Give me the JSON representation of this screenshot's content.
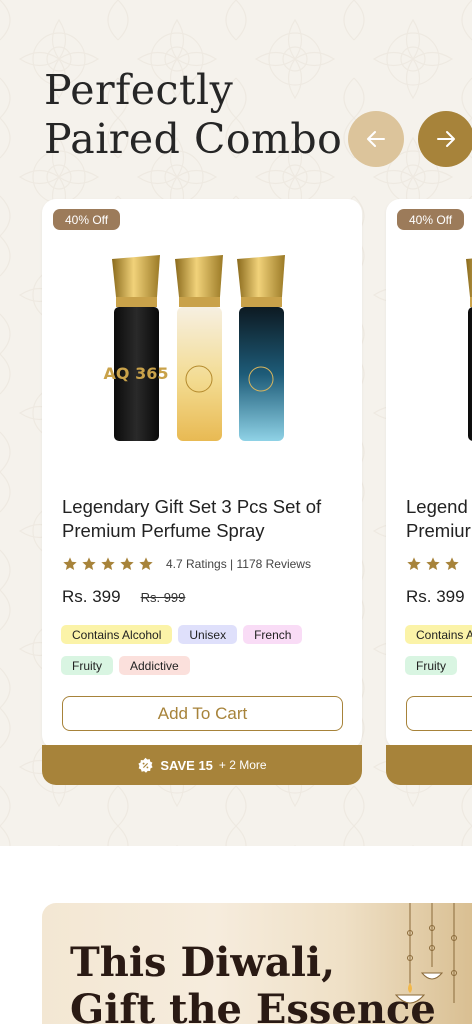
{
  "section": {
    "title_line1": "Perfectly",
    "title_line2": "Paired Combo"
  },
  "products": [
    {
      "discount": "40% Off",
      "name": "Legendary Gift Set 3 Pcs Set of Premium Perfume Spray",
      "rating_text": "4.7 Ratings | 1178 Reviews",
      "rating": 5,
      "price": "Rs. 399",
      "mrp": "Rs. 999",
      "tags": [
        "Contains Alcohol",
        "Unisex",
        "French",
        "Fruity",
        "Addictive"
      ],
      "add_to_cart": "Add To Cart",
      "save_label": "SAVE 15",
      "save_more": "+ 2 More",
      "bottle_labels": [
        "AQ 365"
      ]
    },
    {
      "discount": "40% Off",
      "name_line1": "Legend",
      "name_line2": "Premiur",
      "price": "Rs. 399",
      "tags": [
        "Contains A",
        "Fruity"
      ]
    }
  ],
  "banner": {
    "title_line1": "This Diwali,",
    "title_line2": "Gift the Essence"
  },
  "colors": {
    "accent": "#a7833a",
    "accent_light": "#dcc49b",
    "badge": "#9c7b5a",
    "star": "#a7833a",
    "tag_alcohol": "#fbf3a8",
    "tag_unisex": "#dfe0fb",
    "tag_french": "#f9dcf6",
    "tag_fruity": "#d9f5e2",
    "tag_addictive": "#fbe0dc"
  }
}
